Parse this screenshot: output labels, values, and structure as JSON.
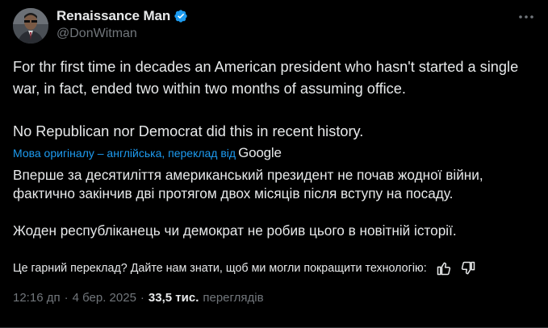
{
  "author": {
    "display_name": "Renaissance Man",
    "handle": "@DonWitman",
    "verified_color": "#1d9bf0",
    "avatar": "man-in-suit-with-sunglasses-avatar"
  },
  "tweet": {
    "paragraph_1": "For thr first time in decades an American president who hasn't started a single war, in fact, ended two within two months of assuming office.",
    "paragraph_2": "No Republican nor Democrat did this in recent history."
  },
  "translation": {
    "source_note": "Мова оригіналу – англійська, переклад від",
    "provider": "Google",
    "paragraph_1": "Вперше за десятиліття американський президент не почав жодної війни, фактично закінчив дві протягом двох місяців після вступу на посаду.",
    "paragraph_2": "Жоден республіканець чи демократ не робив цього в новітній історії.",
    "feedback_prompt": "Це гарний переклад? Дайте нам знати, щоб ми могли покращити технологію:"
  },
  "meta": {
    "time": "12:16 дп",
    "separator": "·",
    "date": "4 бер. 2025",
    "views_count": "33,5 тис.",
    "views_label": "переглядів"
  },
  "colors": {
    "background": "#000000",
    "text": "#e7e9ea",
    "muted": "#71767b",
    "link": "#1d9bf0"
  },
  "icons": {
    "more": "more-horizontal-icon",
    "thumbs_up": "thumbs-up-icon",
    "thumbs_down": "thumbs-down-icon",
    "verified": "verified-badge-icon"
  }
}
